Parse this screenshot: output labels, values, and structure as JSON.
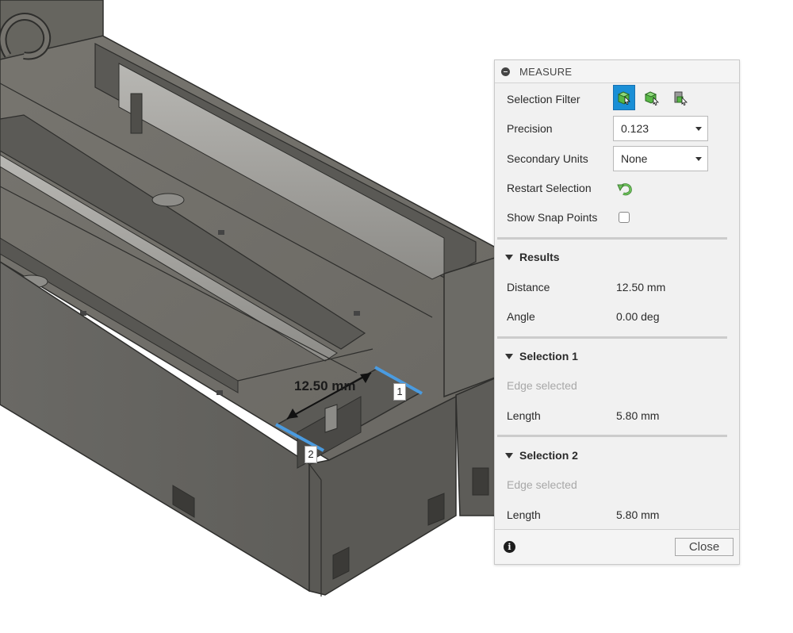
{
  "viewport": {
    "dimension_label": "12.50 mm",
    "point_1": "1",
    "point_2": "2"
  },
  "dialog": {
    "title": "MEASURE",
    "selection_filter_label": "Selection Filter",
    "precision_label": "Precision",
    "precision_value": "0.123",
    "secondary_units_label": "Secondary Units",
    "secondary_units_value": "None",
    "restart_selection_label": "Restart Selection",
    "show_snap_points_label": "Show Snap Points",
    "results": {
      "heading": "Results",
      "distance_label": "Distance",
      "distance_value": "12.50 mm",
      "angle_label": "Angle",
      "angle_value": "0.00 deg"
    },
    "selection1": {
      "heading": "Selection 1",
      "status": "Edge selected",
      "length_label": "Length",
      "length_value": "5.80 mm"
    },
    "selection2": {
      "heading": "Selection 2",
      "status": "Edge selected",
      "length_label": "Length",
      "length_value": "5.80 mm"
    },
    "close_label": "Close"
  },
  "colors": {
    "accent": "#1a8fd6",
    "model_face": "#6b6a66",
    "selection_edge": "#4a9be0",
    "restart_green": "#5aa84a"
  }
}
